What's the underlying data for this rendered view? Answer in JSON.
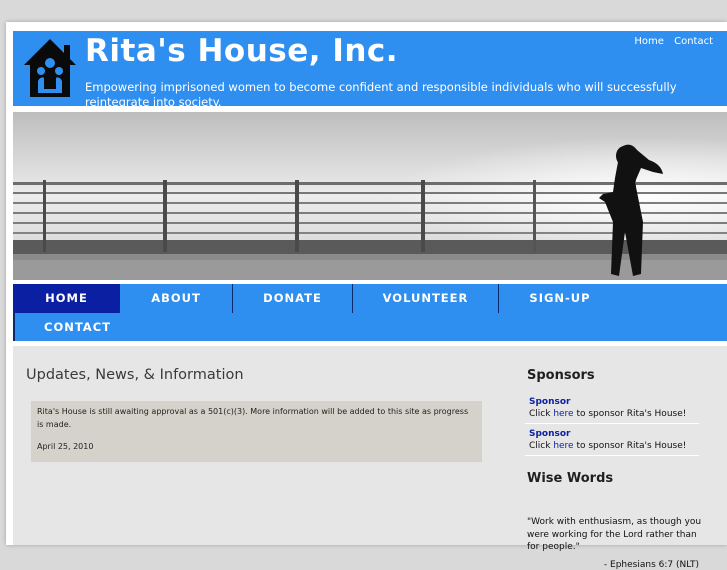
{
  "header": {
    "title": "Rita's House, Inc.",
    "tagline": "Empowering imprisoned women to become confident and responsible individuals who will successfully reintegrate into society.",
    "toplinks": [
      "Home",
      "Contact"
    ]
  },
  "nav": {
    "items": [
      "HOME",
      "ABOUT",
      "DONATE",
      "VOLUNTEER",
      "SIGN-UP",
      "CONTACT"
    ],
    "active": "HOME"
  },
  "main": {
    "title": "Updates, News, & Information",
    "news_text": "Rita's House is still awaiting approval as a 501(c)(3). More information will be added to this site as progress is made.",
    "news_date": "April 25, 2010"
  },
  "sidebar": {
    "sponsors_heading": "Sponsors",
    "sponsors": [
      {
        "name": "Sponsor",
        "prefix": "Click ",
        "link": "here",
        "suffix": " to sponsor Rita's House!"
      },
      {
        "name": "Sponsor",
        "prefix": "Click ",
        "link": "here",
        "suffix": " to sponsor Rita's House!"
      }
    ],
    "wise_heading": "Wise Words",
    "quote": "\"Work with enthusiasm, as though you were working for the Lord rather than for people.\"",
    "quote_cite": "- Ephesians 6:7 (NLT)"
  },
  "colors": {
    "header_blue": "#2f8ff0",
    "nav_active": "#0b1fa3",
    "content_bg": "#e6e6e6",
    "news_box": "#d4d2ca"
  }
}
